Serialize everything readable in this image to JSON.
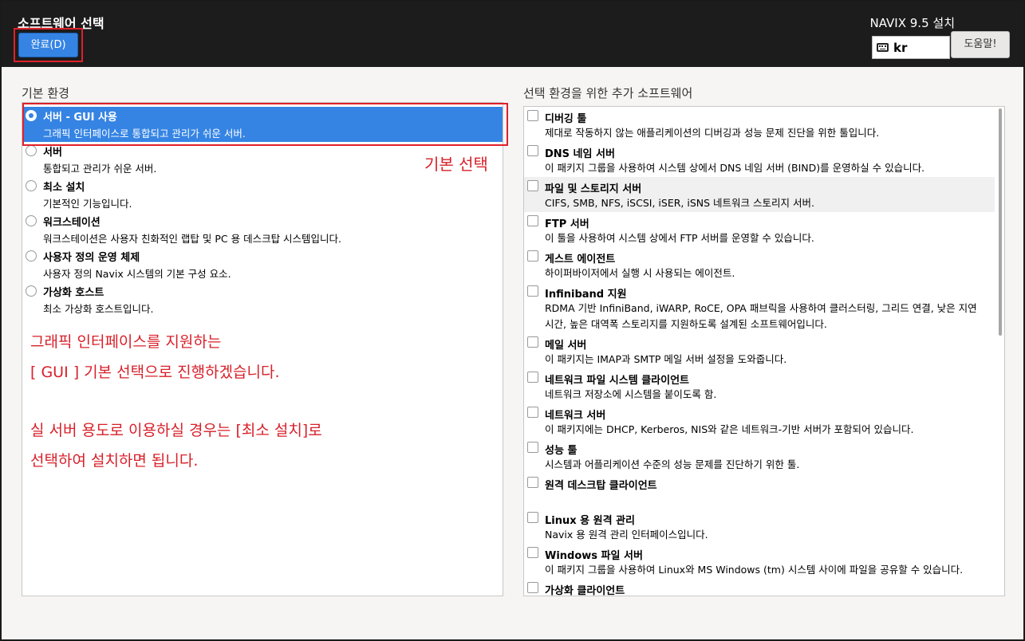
{
  "header": {
    "title": "소프트웨어 선택",
    "done_label": "완료(D)",
    "install_title": "NAVIX 9.5 설치",
    "keyboard_layout": "kr",
    "help_label": "도움말!"
  },
  "base_env": {
    "title": "기본 환경",
    "items": [
      {
        "name": "서버 - GUI 사용",
        "desc": "그래픽 인터페이스로 통합되고 관리가 쉬운 서버."
      },
      {
        "name": "서버",
        "desc": "통합되고 관리가 쉬운 서버."
      },
      {
        "name": "최소 설치",
        "desc": "기본적인 기능입니다."
      },
      {
        "name": "워크스테이션",
        "desc": "워크스테이션은 사용자 친화적인 랩탑 및 PC 용 데스크탑 시스템입니다."
      },
      {
        "name": "사용자 정의 운영 체제",
        "desc": "사용자 정의 Navix 시스템의 기본 구성 요소."
      },
      {
        "name": "가상화 호스트",
        "desc": "최소 가상화 호스트입니다."
      }
    ]
  },
  "annotations": {
    "default_select": "기본 선택",
    "line1": "그래픽 인터페이스를 지원하는",
    "line2": "[ GUI ] 기본 선택으로 진행하겠습니다.",
    "line3": "실 서버 용도로 이용하실 경우는 [최소 설치]로",
    "line4": "선택하여 설치하면 됩니다.",
    "color": "#d8202a"
  },
  "addons": {
    "title": "선택 환경을 위한 추가 소프트웨어",
    "items": [
      {
        "name": "디버깅 툴",
        "desc": "제대로 작동하지 않는 애플리케이션의 디버깅과 성능 문제 진단을 위한 툴입니다."
      },
      {
        "name": "DNS 네임 서버",
        "desc": "이 패키지 그룹을 사용하여 시스템 상에서 DNS 네임 서버 (BIND)를 운영하실 수 있습니다."
      },
      {
        "name": "파일 및 스토리지 서버",
        "desc": "CIFS, SMB, NFS, iSCSI, iSER, iSNS 네트워크 스토리지 서버."
      },
      {
        "name": "FTP 서버",
        "desc": "이 툴을 사용하여 시스템 상에서 FTP 서버를 운영할 수 있습니다."
      },
      {
        "name": "게스트 에이전트",
        "desc": "하이퍼바이저에서 실행 시 사용되는 에이전트."
      },
      {
        "name": "Infiniband 지원",
        "desc": "RDMA 기반 InfiniBand, iWARP, RoCE, OPA 패브릭을 사용하여 클러스터링, 그리드 연결, 낮은 지연 시간, 높은 대역폭 스토리지를 지원하도록 설계된 소프트웨어입니다."
      },
      {
        "name": "메일 서버",
        "desc": "이 패키지는 IMAP과 SMTP 메일 서버 설정을 도와줍니다."
      },
      {
        "name": "네트워크 파일 시스템 클라이언트",
        "desc": "네트워크 저장소에 시스템을 붙이도록 함."
      },
      {
        "name": "네트워크 서버",
        "desc": "이 패키지에는 DHCP, Kerberos, NIS와 같은 네트워크-기반 서버가 포함되어 있습니다."
      },
      {
        "name": "성능 툴",
        "desc": "시스템과 어플리케이션 수준의 성능 문제를 진단하기 위한 툴."
      },
      {
        "name": "원격 데스크탑 클라이언트",
        "desc": ""
      },
      {
        "name": "Linux 용 원격 관리",
        "desc": "Navix 용 원격 관리 인터페이스입니다."
      },
      {
        "name": "Windows 파일 서버",
        "desc": "이 패키지 그룹을 사용하여 Linux와 MS Windows (tm) 시스템 사이에 파일을 공유할 수 있습니다."
      },
      {
        "name": "가상화 클라이언트",
        "desc": ""
      }
    ]
  }
}
